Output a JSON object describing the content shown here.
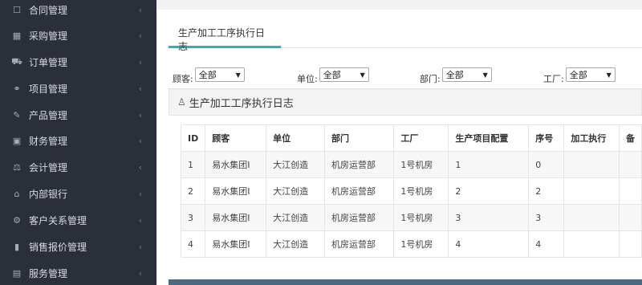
{
  "sidebar": {
    "items": [
      {
        "label": "合同管理",
        "icon": "contract-icon",
        "glyph": "☐"
      },
      {
        "label": "采购管理",
        "icon": "purchase-icon",
        "glyph": "▦"
      },
      {
        "label": "订单管理",
        "icon": "cart-icon",
        "glyph": "⛟"
      },
      {
        "label": "项目管理",
        "icon": "project-icon",
        "glyph": "⚭"
      },
      {
        "label": "产品管理",
        "icon": "product-edit-icon",
        "glyph": "✎"
      },
      {
        "label": "财务管理",
        "icon": "finance-icon",
        "glyph": "▣"
      },
      {
        "label": "会计管理",
        "icon": "scale-icon",
        "glyph": "⚖"
      },
      {
        "label": "内部银行",
        "icon": "bank-icon",
        "glyph": "⌂"
      },
      {
        "label": "客户关系管理",
        "icon": "crm-gears-icon",
        "glyph": "⚙"
      },
      {
        "label": "销售报价管理",
        "icon": "bar-chart-icon",
        "glyph": "▮"
      },
      {
        "label": "服务管理",
        "icon": "service-icon",
        "glyph": "▤"
      }
    ],
    "chevron": "‹"
  },
  "tabs": [
    {
      "label": "生产加工工序执行日志",
      "active": true
    }
  ],
  "filters": [
    {
      "label": "顾客:",
      "value": "全部"
    },
    {
      "label": "单位:",
      "value": "全部"
    },
    {
      "label": "部门:",
      "value": "全部"
    },
    {
      "label": "工厂:",
      "value": "全部"
    }
  ],
  "panel": {
    "title": "生产加工工序执行日志"
  },
  "table": {
    "headers": [
      "ID",
      "顾客",
      "单位",
      "部门",
      "工厂",
      "生产项目配置",
      "序号",
      "加工执行",
      "备"
    ],
    "rows": [
      [
        "1",
        "易水集团I",
        "大江创造",
        "机房运营部",
        "1号机房",
        "1",
        "0",
        "",
        ""
      ],
      [
        "2",
        "易水集团I",
        "大江创造",
        "机房运营部",
        "1号机房",
        "2",
        "2",
        "",
        ""
      ],
      [
        "3",
        "易水集团I",
        "大江创造",
        "机房运营部",
        "1号机房",
        "3",
        "3",
        "",
        ""
      ],
      [
        "4",
        "易水集团I",
        "大江创造",
        "机房运营部",
        "1号机房",
        "4",
        "4",
        "",
        ""
      ]
    ]
  },
  "colors": {
    "sidebar_bg": "#2b2f3a",
    "tab_accent": "#2ab3b2",
    "bottom_bar": "#4b6a82"
  }
}
